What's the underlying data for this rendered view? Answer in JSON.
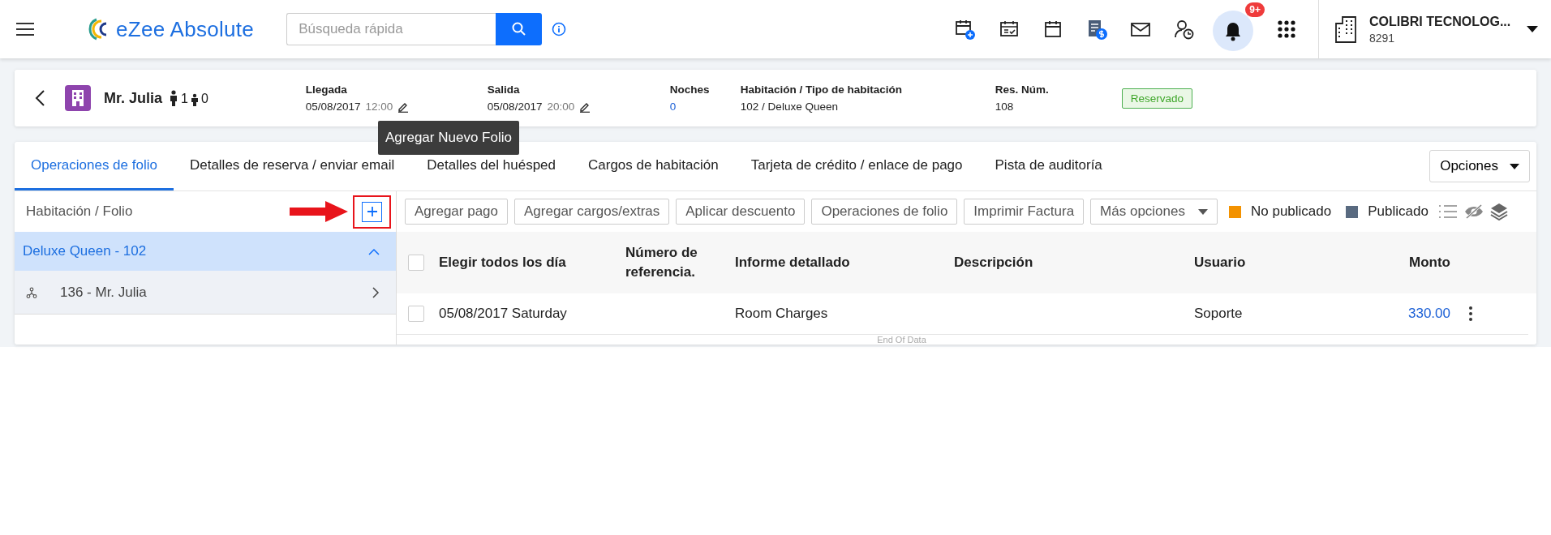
{
  "topbar": {
    "brand": "eZee Absolute",
    "search_placeholder": "Búsqueda rápida",
    "notification_badge": "9+",
    "company": {
      "name": "COLIBRI TECNOLOG...",
      "code": "8291"
    }
  },
  "reservation": {
    "guest": "Mr. Julia",
    "adults": "1",
    "children": "0",
    "status": "Reservado",
    "fields": [
      {
        "kind": "datetime",
        "label": "Llegada",
        "value": "05/08/2017",
        "time": "12:00"
      },
      {
        "kind": "datetime",
        "label": "Salida",
        "value": "05/08/2017",
        "time": "20:00"
      },
      {
        "kind": "count",
        "label": "Noches",
        "value": "0"
      },
      {
        "kind": "text",
        "label": "Habitación / Tipo de habitación",
        "value": "102 / Deluxe Queen"
      },
      {
        "kind": "text",
        "label": "Res. Núm.",
        "value": "108"
      }
    ]
  },
  "tabs": [
    {
      "label": "Operaciones de folio",
      "selected": true
    },
    {
      "label": "Detalles de reserva / enviar email",
      "selected": false
    },
    {
      "label": "Detalles del huésped",
      "selected": false
    },
    {
      "label": "Cargos de habitación",
      "selected": false
    },
    {
      "label": "Tarjeta de crédito / enlace de pago",
      "selected": false
    },
    {
      "label": "Pista de auditoría",
      "selected": false
    }
  ],
  "options_button": "Opciones",
  "tooltip": "Agregar Nuevo Folio",
  "folio_panel": {
    "title": "Habitación / Folio",
    "rooms": [
      {
        "label": "Deluxe Queen - 102",
        "expanded": true,
        "children": [
          {
            "label": "136 - Mr. Julia"
          }
        ]
      }
    ]
  },
  "toolbar": {
    "buttons": [
      "Agregar pago",
      "Agregar cargos/extras",
      "Aplicar descuento",
      "Operaciones de folio",
      "Imprimir Factura"
    ],
    "more": "Más opciones",
    "legend": [
      {
        "label": "No publicado",
        "color": "#f39200"
      },
      {
        "label": "Publicado",
        "color": "#596a80"
      }
    ]
  },
  "table": {
    "select_all_checked": false,
    "columns": [
      "Elegir todos los día",
      "Número de referencia.",
      "Informe detallado",
      "Descripción",
      "Usuario",
      "Monto"
    ],
    "rows": [
      {
        "checked": false,
        "cells": [
          "05/08/2017 Saturday",
          "",
          "Room Charges",
          "",
          "Soporte",
          "330.00"
        ]
      }
    ],
    "footer": "End Of Data"
  }
}
